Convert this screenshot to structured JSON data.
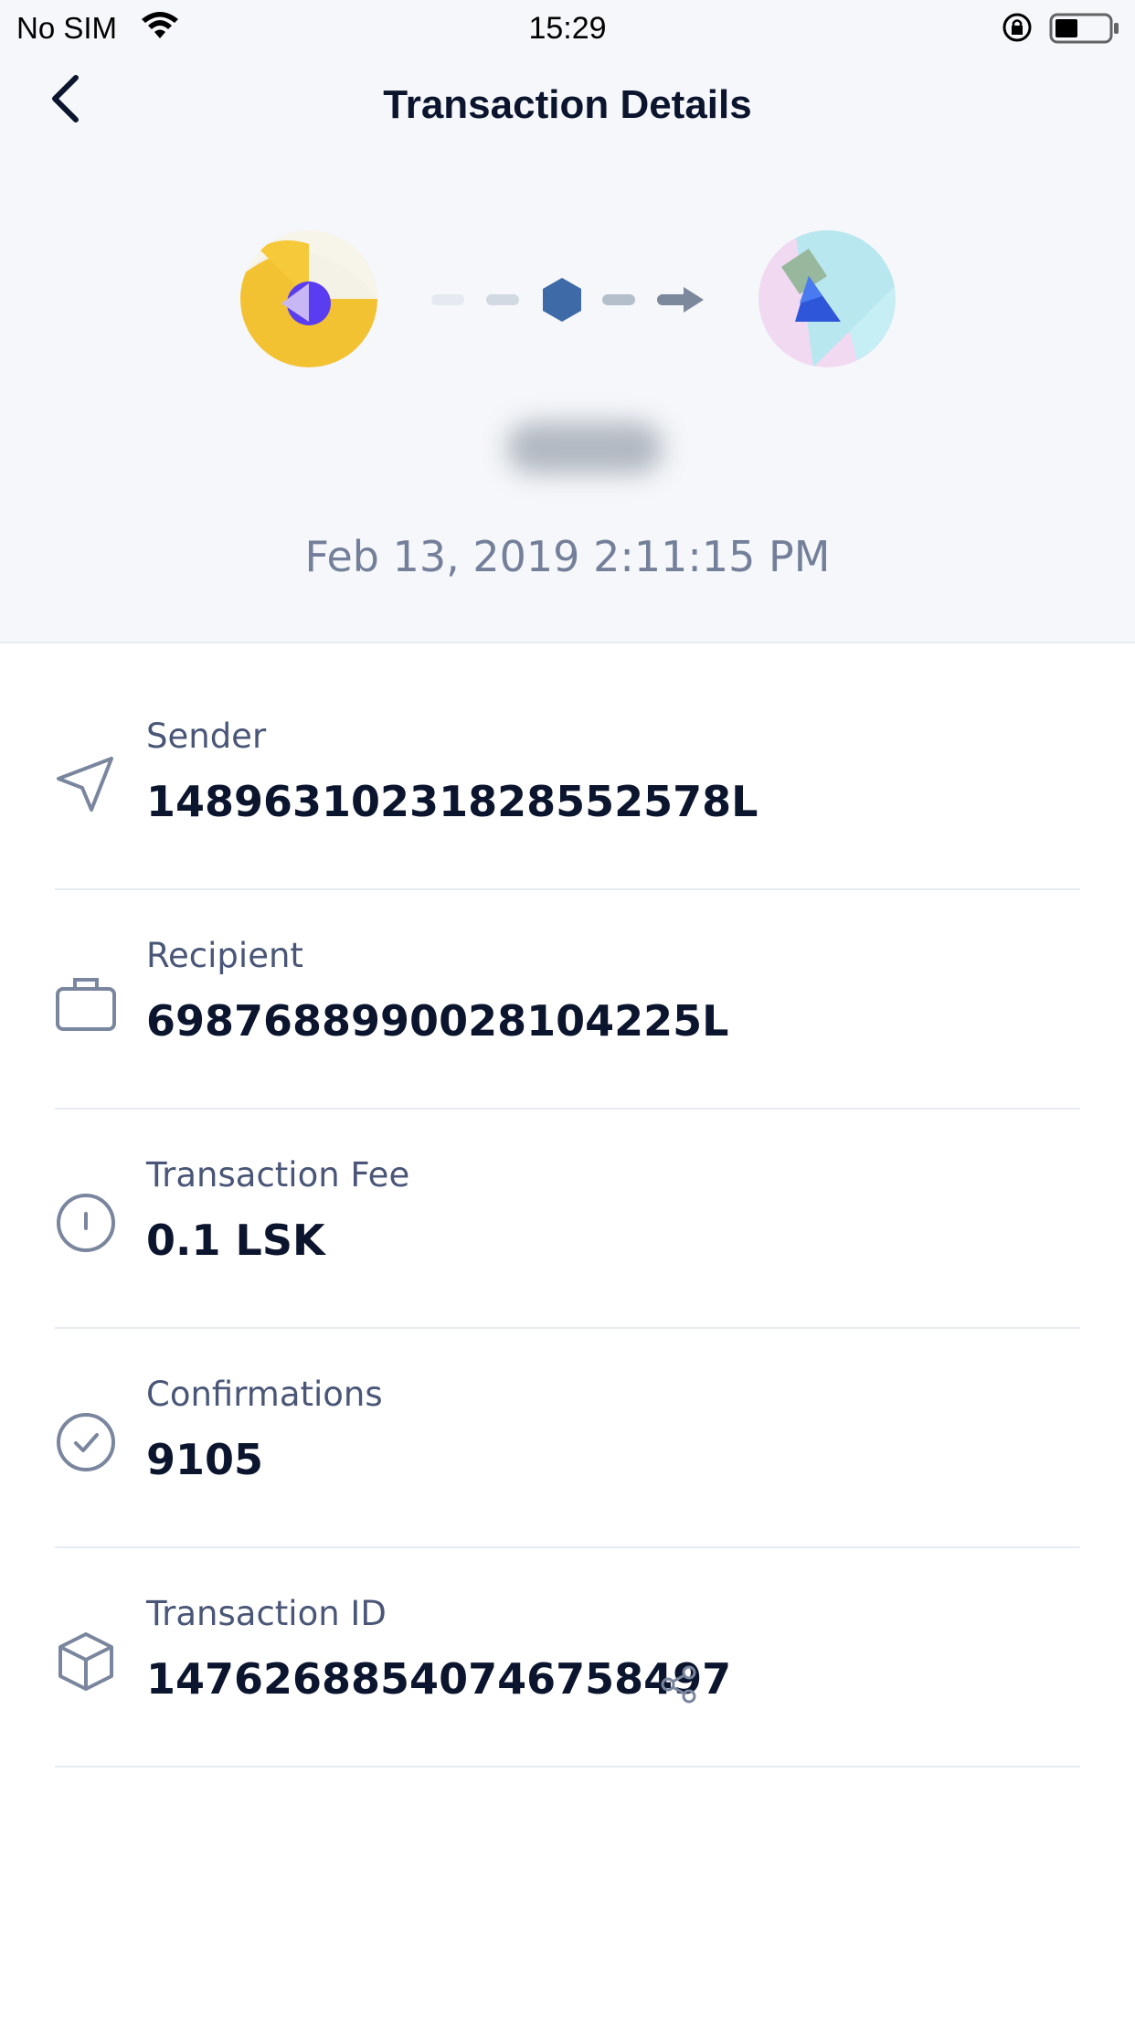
{
  "status_bar": {
    "carrier": "No SIM",
    "time": "15:29"
  },
  "header": {
    "title": "Transaction Details"
  },
  "transaction": {
    "date": "Feb 13, 2019 2:11:15 PM",
    "rows": [
      {
        "label": "Sender",
        "value": "14896310231828552578L",
        "icon": "send-icon"
      },
      {
        "label": "Recipient",
        "value": "6987688990028104225L",
        "icon": "briefcase-icon"
      },
      {
        "label": "Transaction Fee",
        "value": "0.1 LSK",
        "icon": "info-circle-icon"
      },
      {
        "label": "Confirmations",
        "value": "9105",
        "icon": "check-circle-icon"
      },
      {
        "label": "Transaction ID",
        "value": "14762688540746758497",
        "icon": "cube-icon"
      }
    ]
  },
  "colors": {
    "header_bg": "#f5f7fa",
    "divider": "#e6ebf1",
    "label": "#4a5677",
    "value": "#0c152e",
    "hexagon": "#3e6aa8"
  }
}
